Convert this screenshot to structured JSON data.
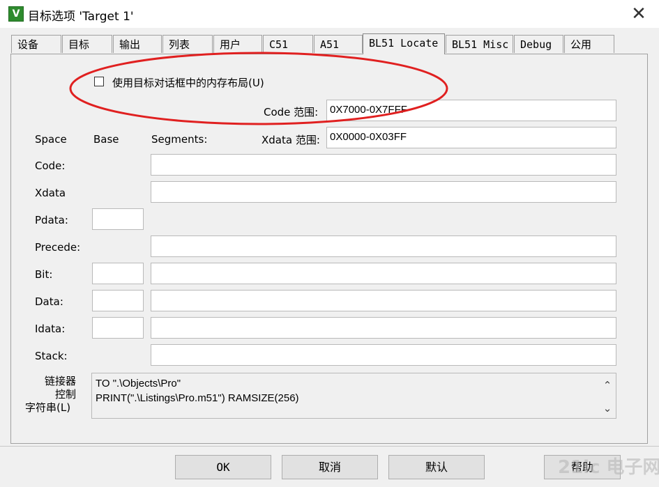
{
  "window": {
    "title": "目标选项 'Target 1'",
    "icon_letter": "V",
    "close_label": "✕"
  },
  "tabs": [
    {
      "label": "设备"
    },
    {
      "label": "目标"
    },
    {
      "label": "输出"
    },
    {
      "label": "列表"
    },
    {
      "label": "用户"
    },
    {
      "label": "C51"
    },
    {
      "label": "A51"
    },
    {
      "label": "BL51 Locate",
      "selected": true
    },
    {
      "label": "BL51 Misc"
    },
    {
      "label": "Debug"
    },
    {
      "label": "公用"
    }
  ],
  "options": {
    "use_memory_layout_label": "使用目标对话框中的内存布局(U)",
    "use_memory_layout_checked": false,
    "code_range_label": "Code 范围:",
    "code_range_value": "0X7000-0X7FFF",
    "xdata_range_label": "Xdata 范围:",
    "xdata_range_value": "0X0000-0X03FF"
  },
  "headers": {
    "space": "Space",
    "base": "Base",
    "segments": "Segments:"
  },
  "rows": {
    "code": {
      "label": "Code:",
      "segments": ""
    },
    "xdata": {
      "label": "Xdata",
      "segments": ""
    },
    "pdata": {
      "label": "Pdata:",
      "base": ""
    },
    "precede": {
      "label": "Precede:",
      "segments": ""
    },
    "bit": {
      "label": "Bit:",
      "base": "",
      "segments": ""
    },
    "data": {
      "label": "Data:",
      "base": "",
      "segments": ""
    },
    "idata": {
      "label": "Idata:",
      "base": "",
      "segments": ""
    },
    "stack": {
      "label": "Stack:",
      "segments": ""
    }
  },
  "linker": {
    "label_line1": "链接器",
    "label_line2": "控制",
    "label_line3": "字符串(L)",
    "text_line1": "TO \".\\Objects\\Pro\"",
    "text_line2": "PRINT(\".\\Listings\\Pro.m51\") RAMSIZE(256)"
  },
  "buttons": {
    "ok": "OK",
    "cancel": "取消",
    "defaults": "默认",
    "help": "帮助"
  },
  "watermark": "21ic 电子网",
  "colors": {
    "highlight_ellipse": "#e02020"
  }
}
